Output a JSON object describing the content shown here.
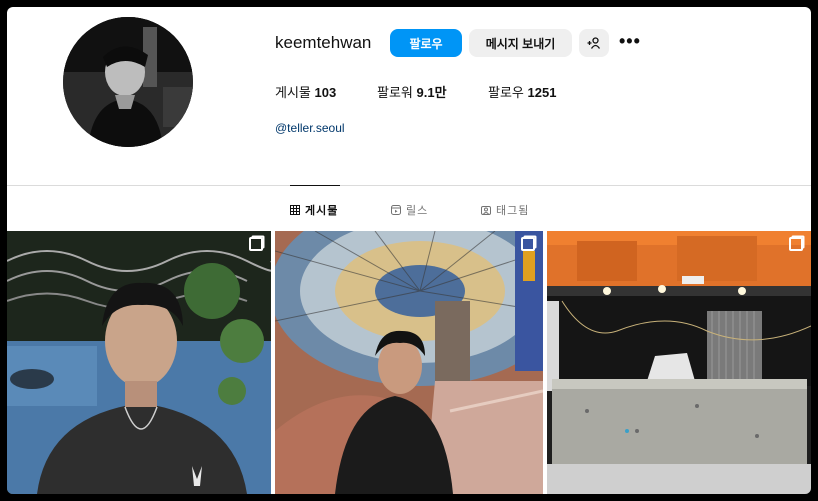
{
  "profile": {
    "username": "keemtehwan",
    "follow_label": "팔로우",
    "message_label": "메시지 보내기",
    "suggest_icon": "person-add-icon",
    "more_icon": "ellipsis-icon",
    "posts_label": "게시물",
    "posts_count": "103",
    "followers_label": "팔로워",
    "followers_count": "9.1만",
    "following_label": "팔로우",
    "following_count": "1251",
    "handle": "@teller.seoul"
  },
  "tabs": [
    {
      "label": "게시물",
      "icon": "grid-icon",
      "active": true
    },
    {
      "label": "릴스",
      "icon": "reels-icon",
      "active": false
    },
    {
      "label": "태그됨",
      "icon": "tagged-icon",
      "active": false
    }
  ],
  "posts": [
    {
      "multi": true
    },
    {
      "multi": true
    },
    {
      "multi": true
    }
  ],
  "colors": {
    "accent": "#0095f6",
    "link": "#00376b",
    "button_bg": "#efefef"
  }
}
